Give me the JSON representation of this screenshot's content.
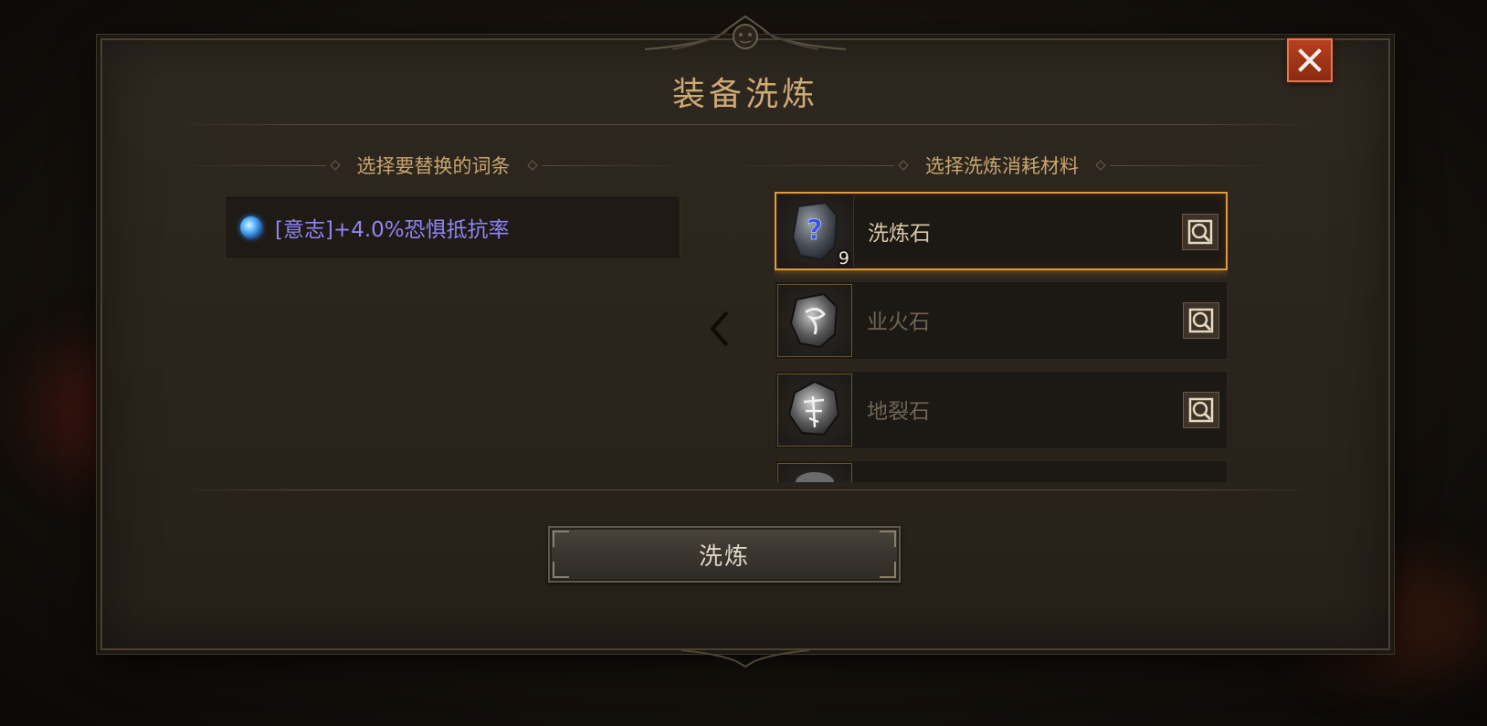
{
  "dialog": {
    "title": "装备洗炼",
    "close_icon": "close-icon"
  },
  "affix_section": {
    "header": "选择要替换的词条",
    "items": [
      {
        "text": "[意志]+4.0%恐惧抵抗率",
        "icon": "blue-gem-icon",
        "color": "#8f86f2"
      }
    ]
  },
  "material_section": {
    "header": "选择洗炼消耗材料",
    "items": [
      {
        "name": "洗炼石",
        "count": "9",
        "selected": true,
        "icon": "refine-stone-icon"
      },
      {
        "name": "业火石",
        "count": "",
        "selected": false,
        "icon": "karma-fire-stone-icon"
      },
      {
        "name": "地裂石",
        "count": "",
        "selected": false,
        "icon": "earth-rift-stone-icon"
      },
      {
        "name": "",
        "count": "",
        "selected": false,
        "icon": "stone-icon"
      }
    ]
  },
  "actions": {
    "refine_label": "洗炼"
  },
  "colors": {
    "accent_gold": "#cda976",
    "selected_border": "#e39a3a",
    "close_red": "#b8401e"
  }
}
